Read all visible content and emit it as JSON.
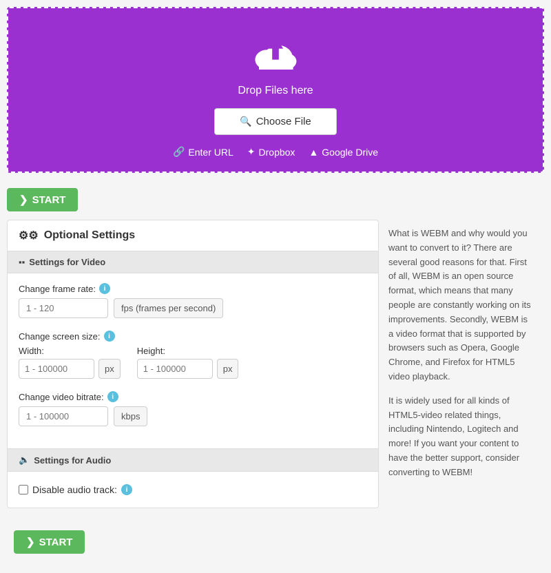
{
  "dropzone": {
    "drop_text": "Drop Files here",
    "choose_file_label": "Choose File",
    "enter_url_label": "Enter URL",
    "dropbox_label": "Dropbox",
    "google_drive_label": "Google Drive"
  },
  "start_button": {
    "label": "START"
  },
  "settings": {
    "title": "Optional Settings",
    "video_section": {
      "header": "Settings for Video",
      "frame_rate": {
        "label": "Change frame rate:",
        "placeholder": "1 - 120",
        "unit": "fps (frames per second)"
      },
      "screen_size": {
        "label": "Change screen size:",
        "width_label": "Width:",
        "width_placeholder": "1 - 100000",
        "width_unit": "px",
        "height_label": "Height:",
        "height_placeholder": "1 - 100000",
        "height_unit": "px"
      },
      "bitrate": {
        "label": "Change video bitrate:",
        "placeholder": "1 - 100000",
        "unit": "kbps"
      }
    },
    "audio_section": {
      "header": "Settings for Audio",
      "disable_audio_label": "Disable audio track:"
    }
  },
  "side_text": {
    "paragraph1": "What is WEBM and why would you want to convert to it? There are several good reasons for that. First of all, WEBM is an open source format, which means that many people are constantly working on its improvements. Secondly, WEBM is a video format that is supported by browsers such as Opera, Google Chrome, and Firefox for HTML5 video playback.",
    "paragraph2": "It is widely used for all kinds of HTML5-video related things, including Nintendo, Logitech and more! If you want your content to have the better support, consider converting to WEBM!"
  },
  "icons": {
    "link": "🔗",
    "dropbox": "✦",
    "google_drive": "▲",
    "video": "▪",
    "audio": "🔈",
    "gear": "⚙",
    "chevron": "❯",
    "search": "🔍",
    "info": "i"
  },
  "colors": {
    "purple": "#9b30d0",
    "green": "#5cb85c",
    "info_blue": "#5bc0de"
  }
}
